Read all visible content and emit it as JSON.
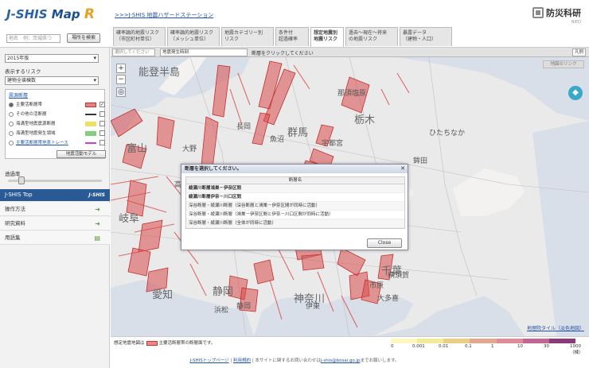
{
  "header": {
    "logo": {
      "jshis": "J-SHIS",
      "map": "Map",
      "r": "R"
    },
    "home_link": ">>>J-SHIS 地震ハザードステーション",
    "brand": "防災科研",
    "brand_sub": "NIED",
    "search_placeholder": "地名　例：茨城県つ",
    "search_button": "場所を検索",
    "tabs": [
      {
        "label": "確率論的地震リスク\n（市区町村単位）",
        "active": false
      },
      {
        "label": "確率論的地震リスク\n（メッシュ単位）",
        "active": false
      },
      {
        "label": "地震カテゴリー別\nリスク",
        "active": false
      },
      {
        "label": "条件付\n超過確率",
        "active": false
      },
      {
        "label": "想定地震別\n地震リスク",
        "active": true
      },
      {
        "label": "過去〜現在〜将来\nの地震リスク",
        "active": false
      },
      {
        "label": "暴露データ\n（建物・人口）",
        "active": false
      }
    ]
  },
  "left": {
    "year_select": "2015年版",
    "risk_label": "表示するリスク",
    "risk_select": "建物全壊棟数",
    "legend_title": "震源断層",
    "legend_rows": [
      {
        "label": "主要活断層帯",
        "color": "#e88080",
        "checked": true,
        "selected": true
      },
      {
        "label": "その他の活断層",
        "color": "#333333",
        "checked": false,
        "selected": false
      },
      {
        "label": "海溝型地震震源断層",
        "color": "#f0e060",
        "checked": false,
        "selected": false
      },
      {
        "label": "海溝型地震発生領域",
        "color": "#80d080",
        "checked": false,
        "selected": false
      },
      {
        "label": "主要活断層帯地表トレース",
        "color": "#d040d0",
        "checked": false,
        "selected": false
      }
    ],
    "model_button": "地震活動モデル",
    "opacity_label": "透過率",
    "opacity_value": 0.12,
    "nav_title": "J-SHIS Top",
    "nav_brand": "J-SHIS",
    "nav_items": [
      "操作方法",
      "研究資料",
      "用語集"
    ]
  },
  "map": {
    "bar_select1": "選択してください",
    "bar_label": "地震発生時刻",
    "bar_hint": "断層をクリックしてください",
    "bar_fig": "凡例",
    "link_button": "地図のリンク",
    "tile_link": "地理院タイル（淡色地図）",
    "labels": [
      {
        "text": "能登半島",
        "cls": ""
      },
      {
        "text": "群馬",
        "cls": ""
      },
      {
        "text": "栃木",
        "cls": ""
      },
      {
        "text": "富山",
        "cls": ""
      },
      {
        "text": "岐阜",
        "cls": ""
      },
      {
        "text": "愛知",
        "cls": ""
      },
      {
        "text": "静岡",
        "cls": ""
      },
      {
        "text": "千葉",
        "cls": ""
      },
      {
        "text": "神奈川",
        "cls": ""
      },
      {
        "text": "宇都宮",
        "cls": "s"
      },
      {
        "text": "那須塩原",
        "cls": "s"
      },
      {
        "text": "ひたちなか",
        "cls": "s"
      },
      {
        "text": "長岡",
        "cls": "s"
      },
      {
        "text": "高山",
        "cls": "s"
      },
      {
        "text": "横須賀",
        "cls": "s"
      },
      {
        "text": "伊東",
        "cls": "s"
      },
      {
        "text": "浜松",
        "cls": "s"
      },
      {
        "text": "市原",
        "cls": "s"
      },
      {
        "text": "大多喜",
        "cls": "s"
      },
      {
        "text": "静岡",
        "cls": "s"
      },
      {
        "text": "大野",
        "cls": "s"
      },
      {
        "text": "東松山",
        "cls": "s"
      },
      {
        "text": "鉾田",
        "cls": "s"
      },
      {
        "text": "魚沼",
        "cls": "s"
      },
      {
        "text": "長岡",
        "cls": "s"
      }
    ]
  },
  "dialog": {
    "title": "断層を選択してください。",
    "header": "断層名",
    "rows": [
      {
        "text": "綾瀬川断層鴻巣－伊奈区間",
        "bold": true
      },
      {
        "text": "綾瀬川断層伊奈－川口区間",
        "bold": true
      },
      {
        "text": "深谷断層・綾瀬川断層（深谷断層と鴻巣－伊奈区間が同時に活動）",
        "bold": false
      },
      {
        "text": "深谷断層・綾瀬川断層（鴻巣－伊奈区間と伊奈－川口区間が同時に活動）",
        "bold": false
      },
      {
        "text": "深谷断層・綾瀬川断層（全体が同時に活動）",
        "bold": false
      }
    ],
    "close": "Close"
  },
  "bottom": {
    "legend_text1": "想定地震地図は",
    "legend_text2": "主要活断層帯の断層面です。",
    "scale_ticks": [
      "0",
      "0.001",
      "0.01",
      "0.1",
      "1",
      "10",
      "30",
      "1000（棟）"
    ],
    "scale_colors": [
      "#fff7c0",
      "#f3eb9a",
      "#e9cf88",
      "#e2a890",
      "#dd8c98",
      "#c06690",
      "#8a3c78"
    ]
  },
  "footer": {
    "link1": "J-SHISトップページ",
    "link2": "利用規約",
    "text": "本サイトに関するお問い合わせは",
    "email": "j-shis@bosai.go.jp",
    "text2": "までお願いします。"
  }
}
